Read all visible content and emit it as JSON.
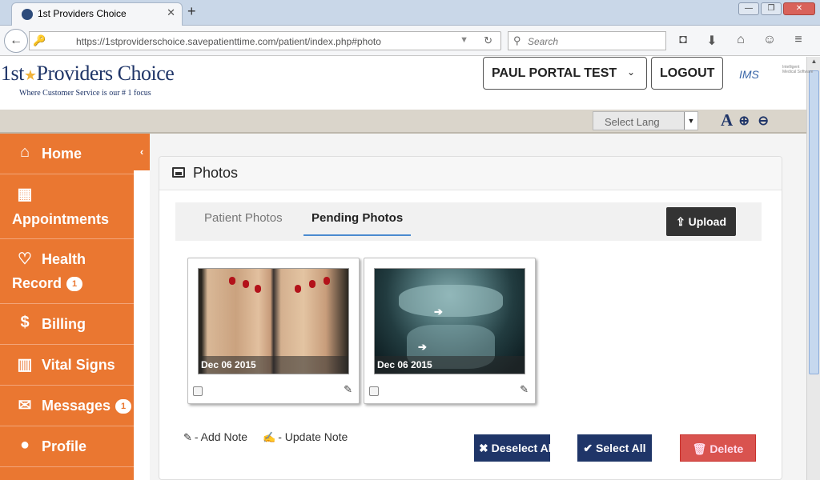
{
  "browser": {
    "tab_title": "1st Providers Choice",
    "tab_close": "✕",
    "new_tab": "+",
    "url": "https://1stproviderschoice.savepatienttime.com/patient/index.php#photo",
    "search_placeholder": "Search",
    "win_min": "—",
    "win_max": "❐",
    "win_close": "✕"
  },
  "header": {
    "logo_part1": "1st",
    "logo_star": "★",
    "logo_part2": "Providers Choice",
    "tagline": "Where Customer Service is our # 1 focus",
    "user_label": "PAUL PORTAL TEST",
    "user_caret": "⌄",
    "logout_label": "LOGOUT",
    "ims_logo": "IMS",
    "ims_sub": "Intelligent Medical Software"
  },
  "langbar": {
    "select_value": "Select Lang",
    "font_icon": "A"
  },
  "sidebar": {
    "items": [
      {
        "label": "Home",
        "icon": "home-icon"
      },
      {
        "label": "Appointments",
        "icon": "calendar-icon"
      },
      {
        "label": "Health",
        "label2": "Record",
        "badge": "1",
        "icon": "heartbeat-icon"
      },
      {
        "label": "Billing",
        "icon": "dollar-icon"
      },
      {
        "label": "Vital Signs",
        "icon": "bar-chart-icon"
      },
      {
        "label": "Messages",
        "badge": "1",
        "icon": "envelope-icon"
      },
      {
        "label": "Profile",
        "icon": "user-icon"
      }
    ]
  },
  "main": {
    "panel_title": "Photos",
    "tabs": [
      {
        "label": "Patient Photos",
        "active": false
      },
      {
        "label": "Pending Photos",
        "active": true
      }
    ],
    "upload_label": "Upload",
    "photos": [
      {
        "date": "Dec 06 2015",
        "subject": "feet"
      },
      {
        "date": "Dec 06 2015",
        "subject": "knee x-ray"
      }
    ],
    "legend_add": "- Add Note",
    "legend_update": "- Update Note",
    "deselect_label": "Deselect All",
    "select_label": "Select All",
    "delete_label": "Delete"
  },
  "colors": {
    "sidebar": "#ea7731",
    "brand_navy": "#1f3568",
    "delete_red": "#d9534f"
  }
}
